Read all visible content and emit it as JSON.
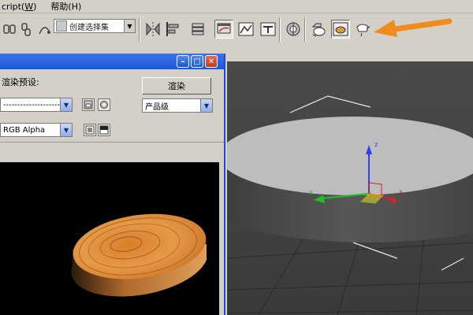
{
  "menu": {
    "script": "cript(&#x1F;)",
    "help": "帮助(H)"
  },
  "toolbar": {
    "selection_set": "创建选择集",
    "icons": [
      "link-icon",
      "unlink-icon",
      "bind-icon",
      "mirror-icon",
      "align-icon",
      "layer-icon",
      "curve-editor-icon",
      "schematic-view-icon",
      "material-editor-icon",
      "render-setup-icon",
      "render-frame-icon",
      "render-production-icon",
      "render-iterative-icon"
    ]
  },
  "annotation": {
    "arrow_color": "#f08c1e"
  },
  "render_window": {
    "preset_label": "渲染预设:",
    "preset_value": "------------------------",
    "render_button": "渲染",
    "quality_value": "产品级",
    "channel_value": "RGB Alpha"
  },
  "viewport": {
    "axis_labels": {
      "z": "z",
      "x": "x",
      "y": "y"
    },
    "colors": {
      "z": "#2a3ff0",
      "x": "#e02020",
      "y": "#20c020",
      "plane": "#e0d020"
    }
  }
}
